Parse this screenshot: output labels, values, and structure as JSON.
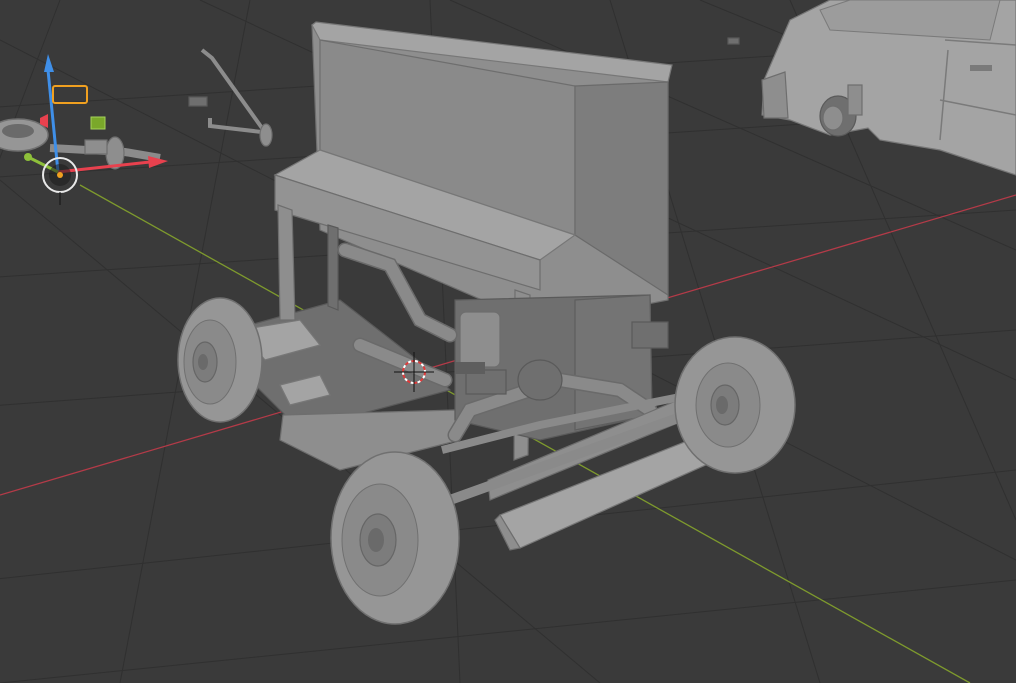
{
  "viewport": {
    "background": "#393939",
    "grid_color": "#303030",
    "axis_x_color": "#b43a48",
    "axis_y_color": "#7e9a2d",
    "model_color": "#8e8e8e"
  },
  "gizmo": {
    "axes": [
      "x",
      "y",
      "z"
    ],
    "axis_colors": {
      "x": "#e8414e",
      "y": "#8ec03a",
      "z": "#3f8fe8"
    },
    "icons": [
      "camera-icon",
      "light-icon",
      "move-gizmo-icon"
    ]
  },
  "scene_objects": [
    "piano-car",
    "car-body",
    "steering-rod",
    "wheel-assembly"
  ],
  "cursor_3d": {
    "icon": "3d-cursor-icon",
    "color": "#e03a3a"
  }
}
